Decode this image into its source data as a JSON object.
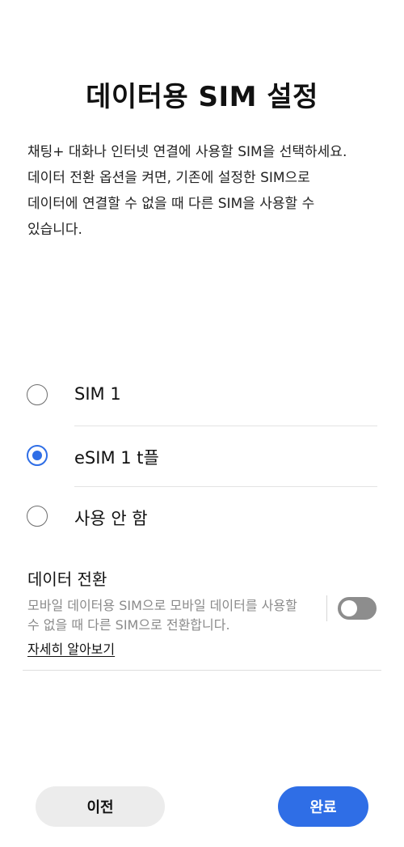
{
  "title": "데이터용 SIM 설정",
  "description": [
    "채팅+ 대화나 인터넷 연결에 사용할 SIM을 선택하세요.",
    "데이터 전환 옵션을 켜면, 기존에 설정한 SIM으로",
    "데이터에 연결할 수 없을 때 다른 SIM을 사용할 수",
    "있습니다."
  ],
  "options": [
    {
      "label": "SIM 1",
      "selected": false
    },
    {
      "label": "eSIM 1 t플",
      "selected": true
    },
    {
      "label": "사용 안 함",
      "selected": false
    }
  ],
  "data_switch": {
    "title": "데이터 전환",
    "description": "모바일 데이터용 SIM으로 모바일 데이터를 사용할 수 없을 때 다른 SIM으로 전환합니다.",
    "learn_more": "자세히 알아보기",
    "enabled": false
  },
  "buttons": {
    "prev": "이전",
    "done": "완료"
  },
  "colors": {
    "accent": "#2f6ee6",
    "toggle_off": "#8d8d8d"
  }
}
